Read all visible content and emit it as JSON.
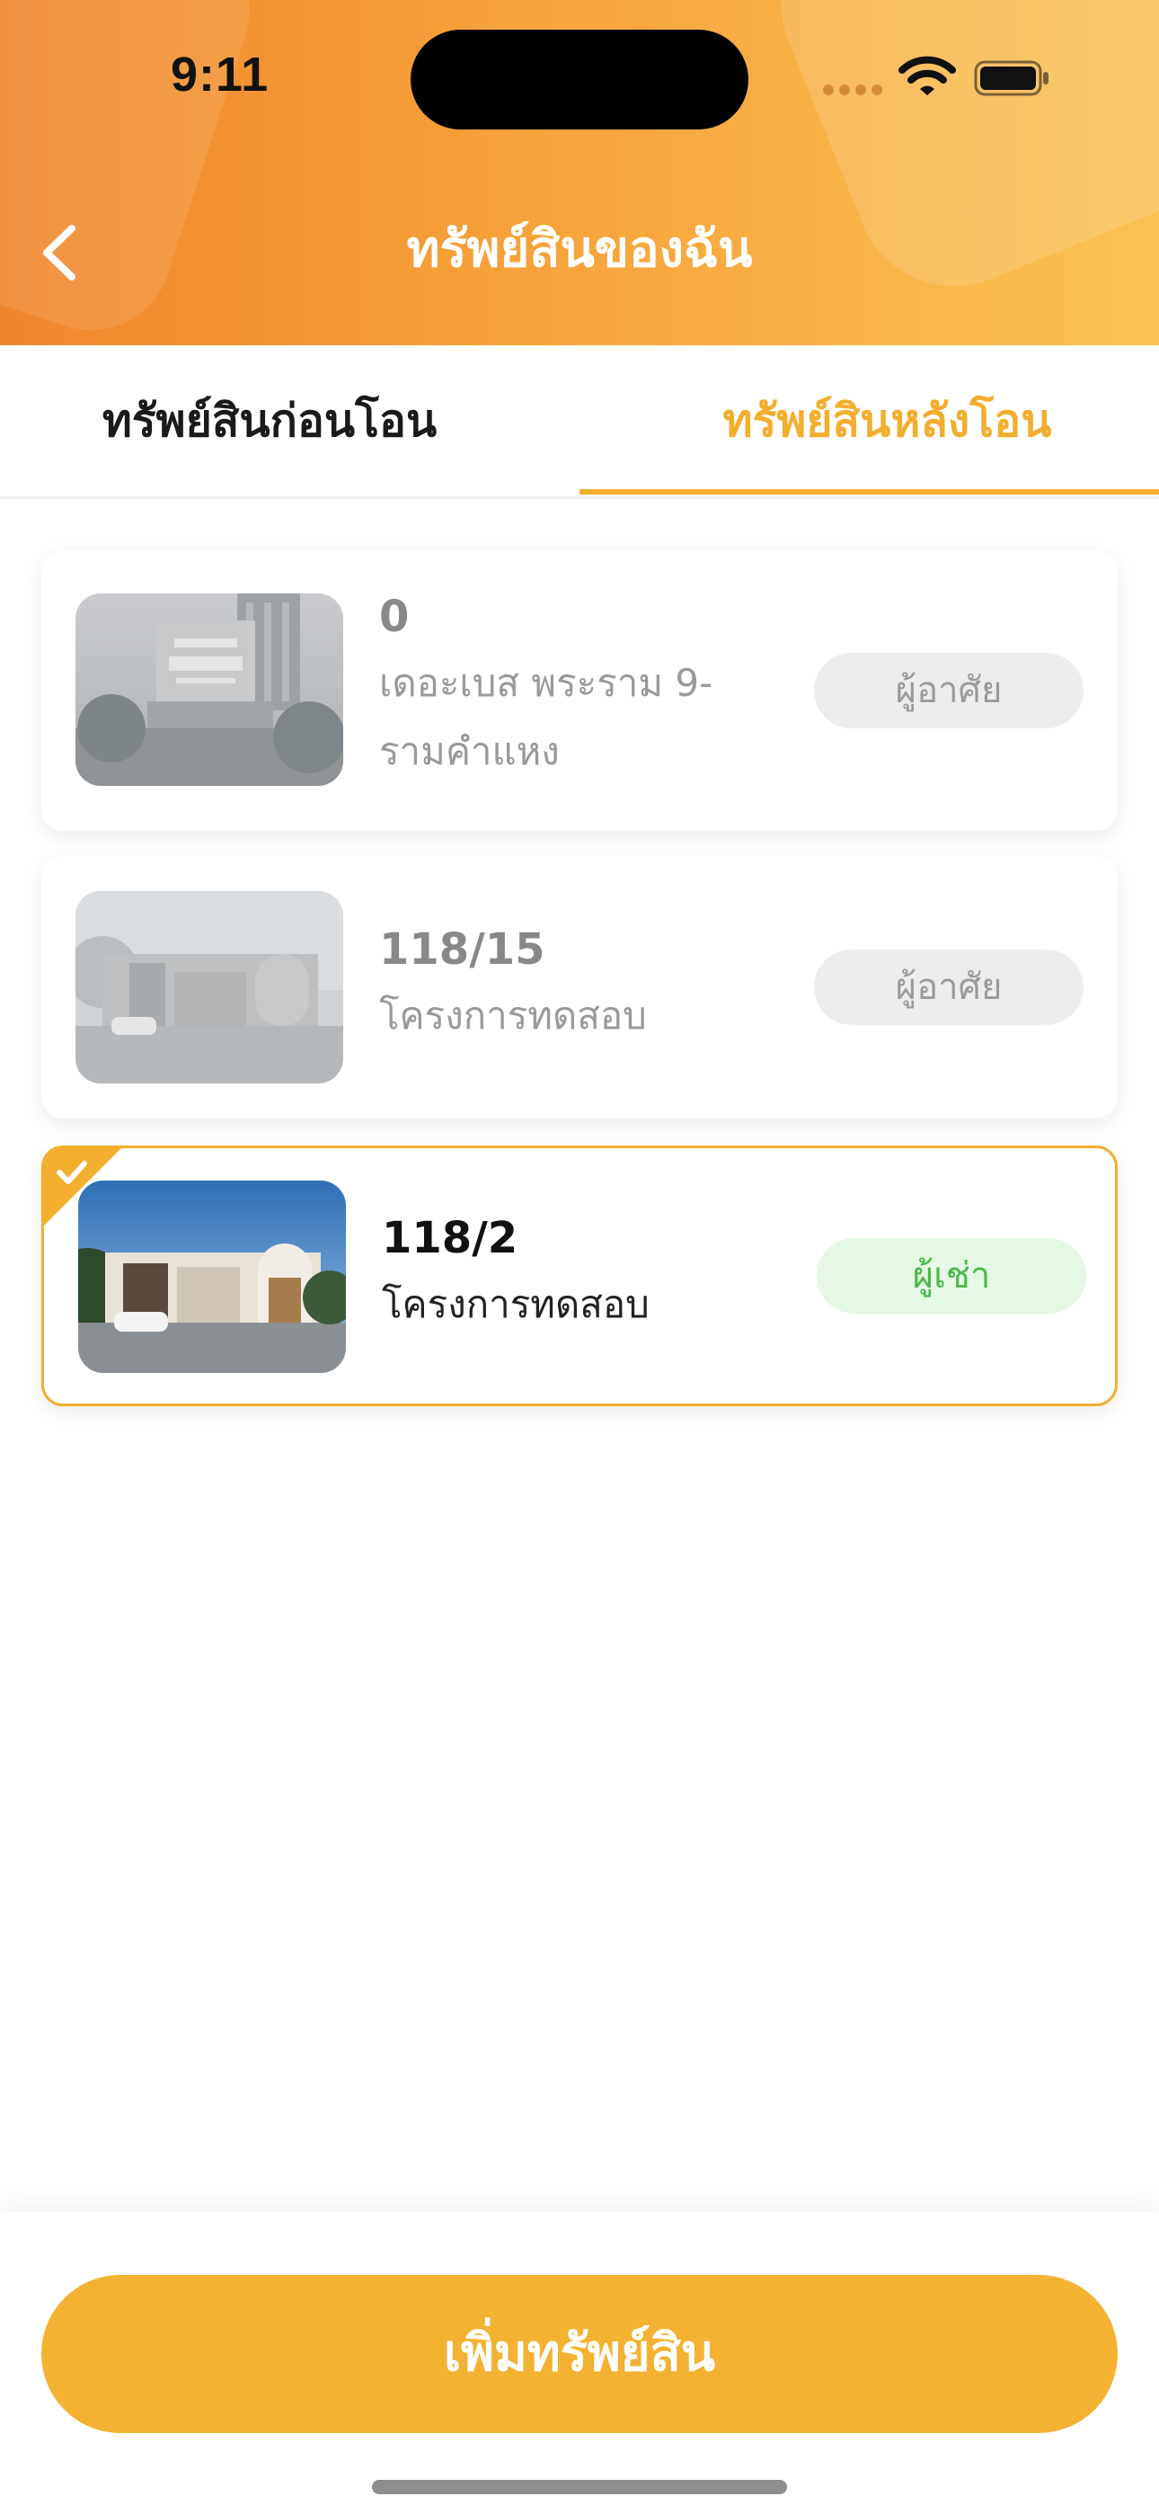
{
  "status_bar": {
    "time": "9:11"
  },
  "header": {
    "title": "ทรัพย์สินของฉัน",
    "back_icon": "chevron-left-icon"
  },
  "tabs": [
    {
      "label": "ทรัพย์สินก่อนโอน",
      "selected": false
    },
    {
      "label": "ทรัพย์สินหลังโอน",
      "selected": true
    }
  ],
  "assets": [
    {
      "unit_no": "0",
      "project": "เดอะเบส พระราม 9-รามคำแหง",
      "role": "ผู้อาศัย",
      "selected": false,
      "thumbnail": "building-photo"
    },
    {
      "unit_no": "118/15",
      "project": "โครงการทดสอบ",
      "role": "ผู้อาศัย",
      "selected": false,
      "thumbnail": "village-gate-photo"
    },
    {
      "unit_no": "118/2",
      "project": "โครงการทดสอบ",
      "role": "ผู้เช่า",
      "selected": true,
      "thumbnail": "village-gate-photo"
    }
  ],
  "footer": {
    "add_button_label": "เพิ่มทรัพย์สิน"
  },
  "colors": {
    "accent": "#F3AE2E",
    "header_gradient_start": "#F0862E",
    "header_gradient_end": "#FBC154",
    "tenant_badge_text": "#4CB74A",
    "resident_badge_text": "#9A9A9A"
  }
}
